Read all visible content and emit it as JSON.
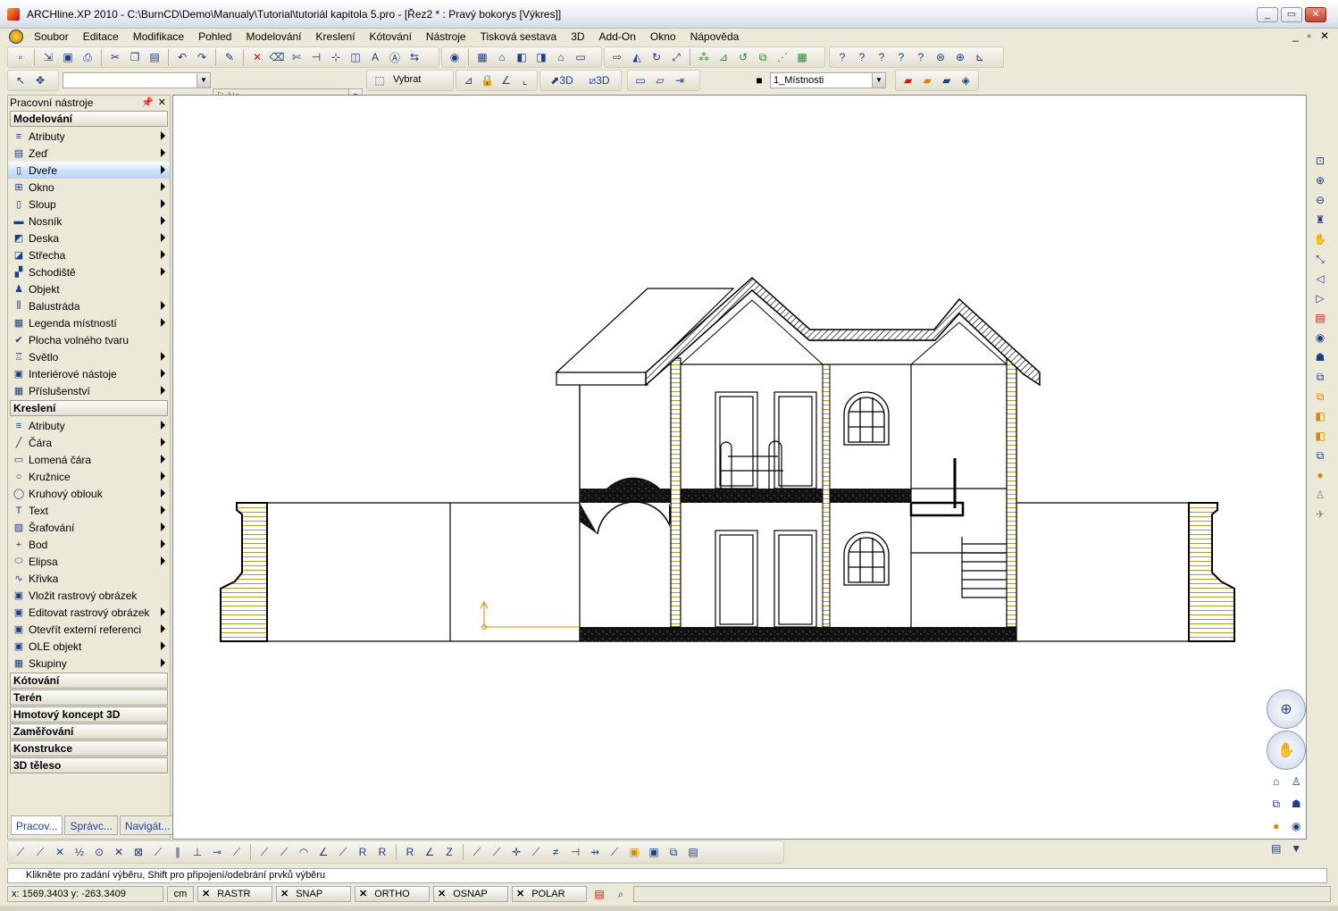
{
  "window": {
    "title": "ARCHline.XP 2010 - C:\\BurnCD\\Demo\\Manualy\\Tutorial\\tutoriál kapitola 5.pro - [Řez2 * : Pravý bokorys [Výkres]]",
    "minimize": "_",
    "maximize": "▭",
    "close": "✕"
  },
  "menu": {
    "items": [
      "Soubor",
      "Editace",
      "Modifikace",
      "Pohled",
      "Modelování",
      "Kreslení",
      "Kótování",
      "Nástroje",
      "Tisková sestava",
      "3D",
      "Add-On",
      "Okno",
      "Nápověda"
    ],
    "mdi": [
      "_",
      "▫",
      "✕"
    ]
  },
  "toolbar2": {
    "layer_combo": "",
    "line_combo": "Ne",
    "select_label": "Vybrat",
    "btn_3d_a": "3D",
    "btn_3d_b": "3D",
    "room_combo": "1_Místnosti"
  },
  "panel": {
    "title": "Pracovní nástroje",
    "pin": "📌",
    "close": "✕",
    "sections": [
      {
        "name": "Modelování",
        "tools": [
          {
            "label": "Atributy",
            "icon": "attributes-icon",
            "sub": true
          },
          {
            "label": "Zeď",
            "icon": "wall-icon",
            "sub": true
          },
          {
            "label": "Dveře",
            "icon": "door-icon",
            "sub": true,
            "selected": true
          },
          {
            "label": "Okno",
            "icon": "window-icon",
            "sub": true
          },
          {
            "label": "Sloup",
            "icon": "column-icon",
            "sub": true
          },
          {
            "label": "Nosník",
            "icon": "beam-icon",
            "sub": true
          },
          {
            "label": "Deska",
            "icon": "slab-icon",
            "sub": true
          },
          {
            "label": "Střecha",
            "icon": "roof-icon",
            "sub": true
          },
          {
            "label": "Schodiště",
            "icon": "stairs-icon",
            "sub": true
          },
          {
            "label": "Objekt",
            "icon": "object-icon",
            "sub": false
          },
          {
            "label": "Balustráda",
            "icon": "railing-icon",
            "sub": true
          },
          {
            "label": "Legenda místností",
            "icon": "room-legend-icon",
            "sub": true
          },
          {
            "label": "Plocha volného tvaru",
            "icon": "freeform-surface-icon",
            "sub": false
          },
          {
            "label": "Světlo",
            "icon": "light-icon",
            "sub": true
          },
          {
            "label": "Interiérové nástoje",
            "icon": "interior-tools-icon",
            "sub": true
          },
          {
            "label": "Příslušenství",
            "icon": "accessories-icon",
            "sub": true
          }
        ]
      },
      {
        "name": "Kreslení",
        "tools": [
          {
            "label": "Atributy",
            "icon": "attributes-icon",
            "sub": true
          },
          {
            "label": "Čára",
            "icon": "line-icon",
            "sub": true
          },
          {
            "label": "Lomená čára",
            "icon": "polyline-icon",
            "sub": true
          },
          {
            "label": "Kružnice",
            "icon": "circle-icon",
            "sub": true
          },
          {
            "label": "Kruhový oblouk",
            "icon": "arc-icon",
            "sub": true
          },
          {
            "label": "Text",
            "icon": "text-icon",
            "sub": true
          },
          {
            "label": "Šrafování",
            "icon": "hatch-icon",
            "sub": true
          },
          {
            "label": "Bod",
            "icon": "point-icon",
            "sub": true
          },
          {
            "label": "Elipsa",
            "icon": "ellipse-icon",
            "sub": true
          },
          {
            "label": "Křivka",
            "icon": "curve-icon",
            "sub": false
          },
          {
            "label": "Vložit rastrový obrázek",
            "icon": "insert-raster-icon",
            "sub": false
          },
          {
            "label": "Editovat rastrový obrázek",
            "icon": "edit-raster-icon",
            "sub": true
          },
          {
            "label": "Otevřít externí referenci",
            "icon": "xref-icon",
            "sub": true
          },
          {
            "label": "OLE objekt",
            "icon": "ole-icon",
            "sub": true
          },
          {
            "label": "Skupiny",
            "icon": "groups-icon",
            "sub": true
          }
        ]
      }
    ],
    "collapsed": [
      "Kótování",
      "Terén",
      "Hmotový koncept 3D",
      "Zaměřování",
      "Konstrukce",
      "3D těleso"
    ],
    "tabs": [
      "Pracov...",
      "Správc...",
      "Navigát..."
    ]
  },
  "command_line": "Klikněte pro zadání výběru, Shift pro připojení/odebrání prvků výběru",
  "status": {
    "coords": "x: 1569.3403  y: -263.3409",
    "unit": "cm",
    "toggles": [
      "RASTR",
      "SNAP",
      "ORTHO",
      "OSNAP",
      "POLAR"
    ]
  },
  "colors": {
    "accent": "#d68a00",
    "selection": "#cfe2f9",
    "window_bg": "#ece9d8"
  }
}
